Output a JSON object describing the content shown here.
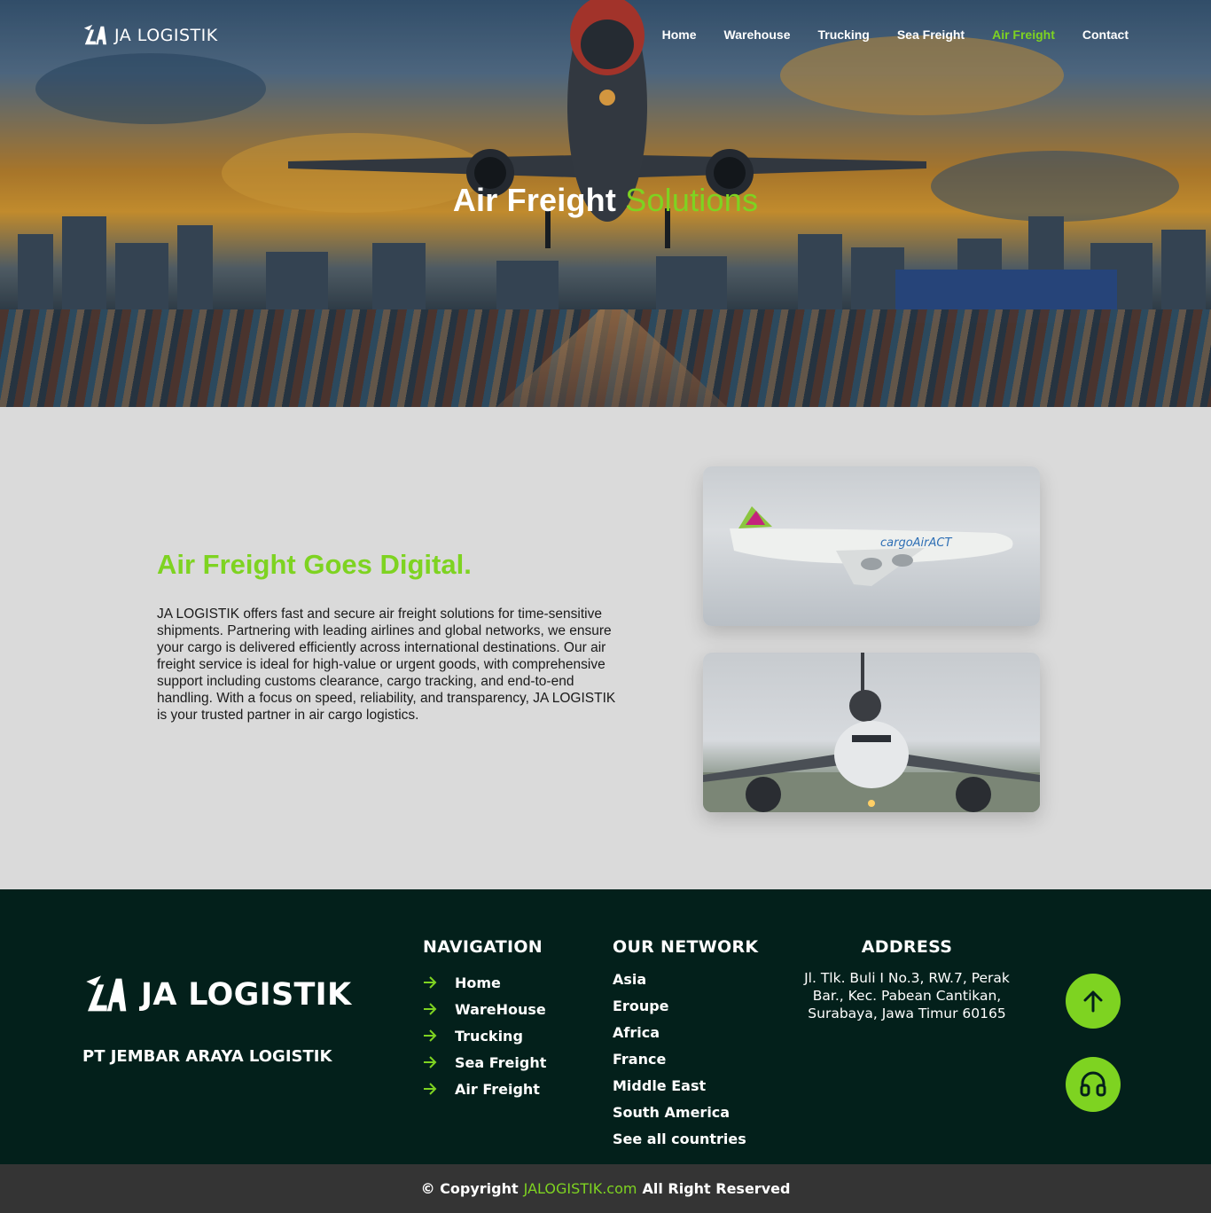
{
  "header": {
    "brand": "JA LOGISTIK",
    "nav": [
      {
        "label": "Home"
      },
      {
        "label": "Warehouse"
      },
      {
        "label": "Trucking"
      },
      {
        "label": "Sea Freight"
      },
      {
        "label": "Air Freight",
        "active": true
      },
      {
        "label": "Contact"
      }
    ]
  },
  "hero": {
    "title_main": "Air Freight",
    "title_accent": "Solutions"
  },
  "intro": {
    "title": "Air Freight Goes Digital.",
    "body": "JA LOGISTIK offers fast and secure air freight solutions for time-sensitive shipments. Partnering with leading airlines and global networks, we ensure your cargo is delivered efficiently across international destinations. Our air freight service is ideal for high-value or urgent goods, with comprehensive support including customs clearance, cargo tracking, and end-to-end handling. With a focus on speed, reliability, and transparency, JA LOGISTIK is your trusted partner in air cargo logistics.",
    "photo1_livery": "cargoAirACT"
  },
  "footer": {
    "brand": "JA LOGISTIK",
    "company": "PT JEMBAR ARAYA LOGISTIK",
    "navigation": {
      "title": "NAVIGATION",
      "items": [
        "Home",
        "WareHouse",
        "Trucking",
        "Sea Freight",
        "Air Freight"
      ]
    },
    "network": {
      "title": "OUR NETWORK",
      "items": [
        "Asia",
        "Eroupe",
        "Africa",
        "France",
        "Middle East",
        "South America",
        "See all countries"
      ]
    },
    "address": {
      "title": "ADDRESS",
      "text": "Jl. Tlk. Buli I No.3, RW.7, Perak Bar., Kec. Pabean Cantikan, Surabaya, Jawa Timur 60165"
    },
    "buttons": {
      "up_icon": "arrow-up-icon",
      "support_icon": "headset-icon"
    }
  },
  "copyright": {
    "prefix": "© Copyright",
    "brand": "JALOGISTIK.com",
    "suffix": "All Right Reserved"
  },
  "colors": {
    "accent": "#7ed321",
    "footer_bg": "#03201b",
    "copyright_bg": "#343434",
    "content_bg": "#dadada"
  }
}
